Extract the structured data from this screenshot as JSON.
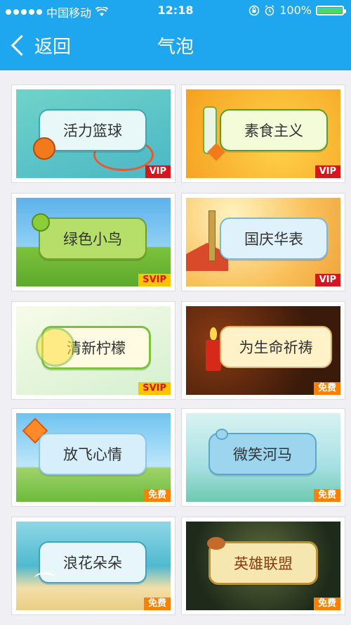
{
  "status_bar": {
    "carrier": "中国移动",
    "time": "12:18",
    "battery": "100%"
  },
  "nav": {
    "back_label": "返回",
    "title": "气泡"
  },
  "bubbles": [
    {
      "name": "活力篮球",
      "tag": "VIP"
    },
    {
      "name": "素食主义",
      "tag": "VIP"
    },
    {
      "name": "绿色小鸟",
      "tag": "SVIP"
    },
    {
      "name": "国庆华表",
      "tag": "VIP"
    },
    {
      "name": "清新柠檬",
      "tag": "SVIP"
    },
    {
      "name": "为生命祈祷",
      "tag": "免费"
    },
    {
      "name": "放飞心情",
      "tag": "免费"
    },
    {
      "name": "微笑河马",
      "tag": "免费"
    },
    {
      "name": "浪花朵朵",
      "tag": "免费"
    },
    {
      "name": "英雄联盟",
      "tag": "免费"
    }
  ],
  "colors": {
    "nav_bg": "#1ea6ee",
    "vip_badge": "#d9141c",
    "svip_badge": "#ffc400",
    "free_badge": "#ff7f00"
  }
}
